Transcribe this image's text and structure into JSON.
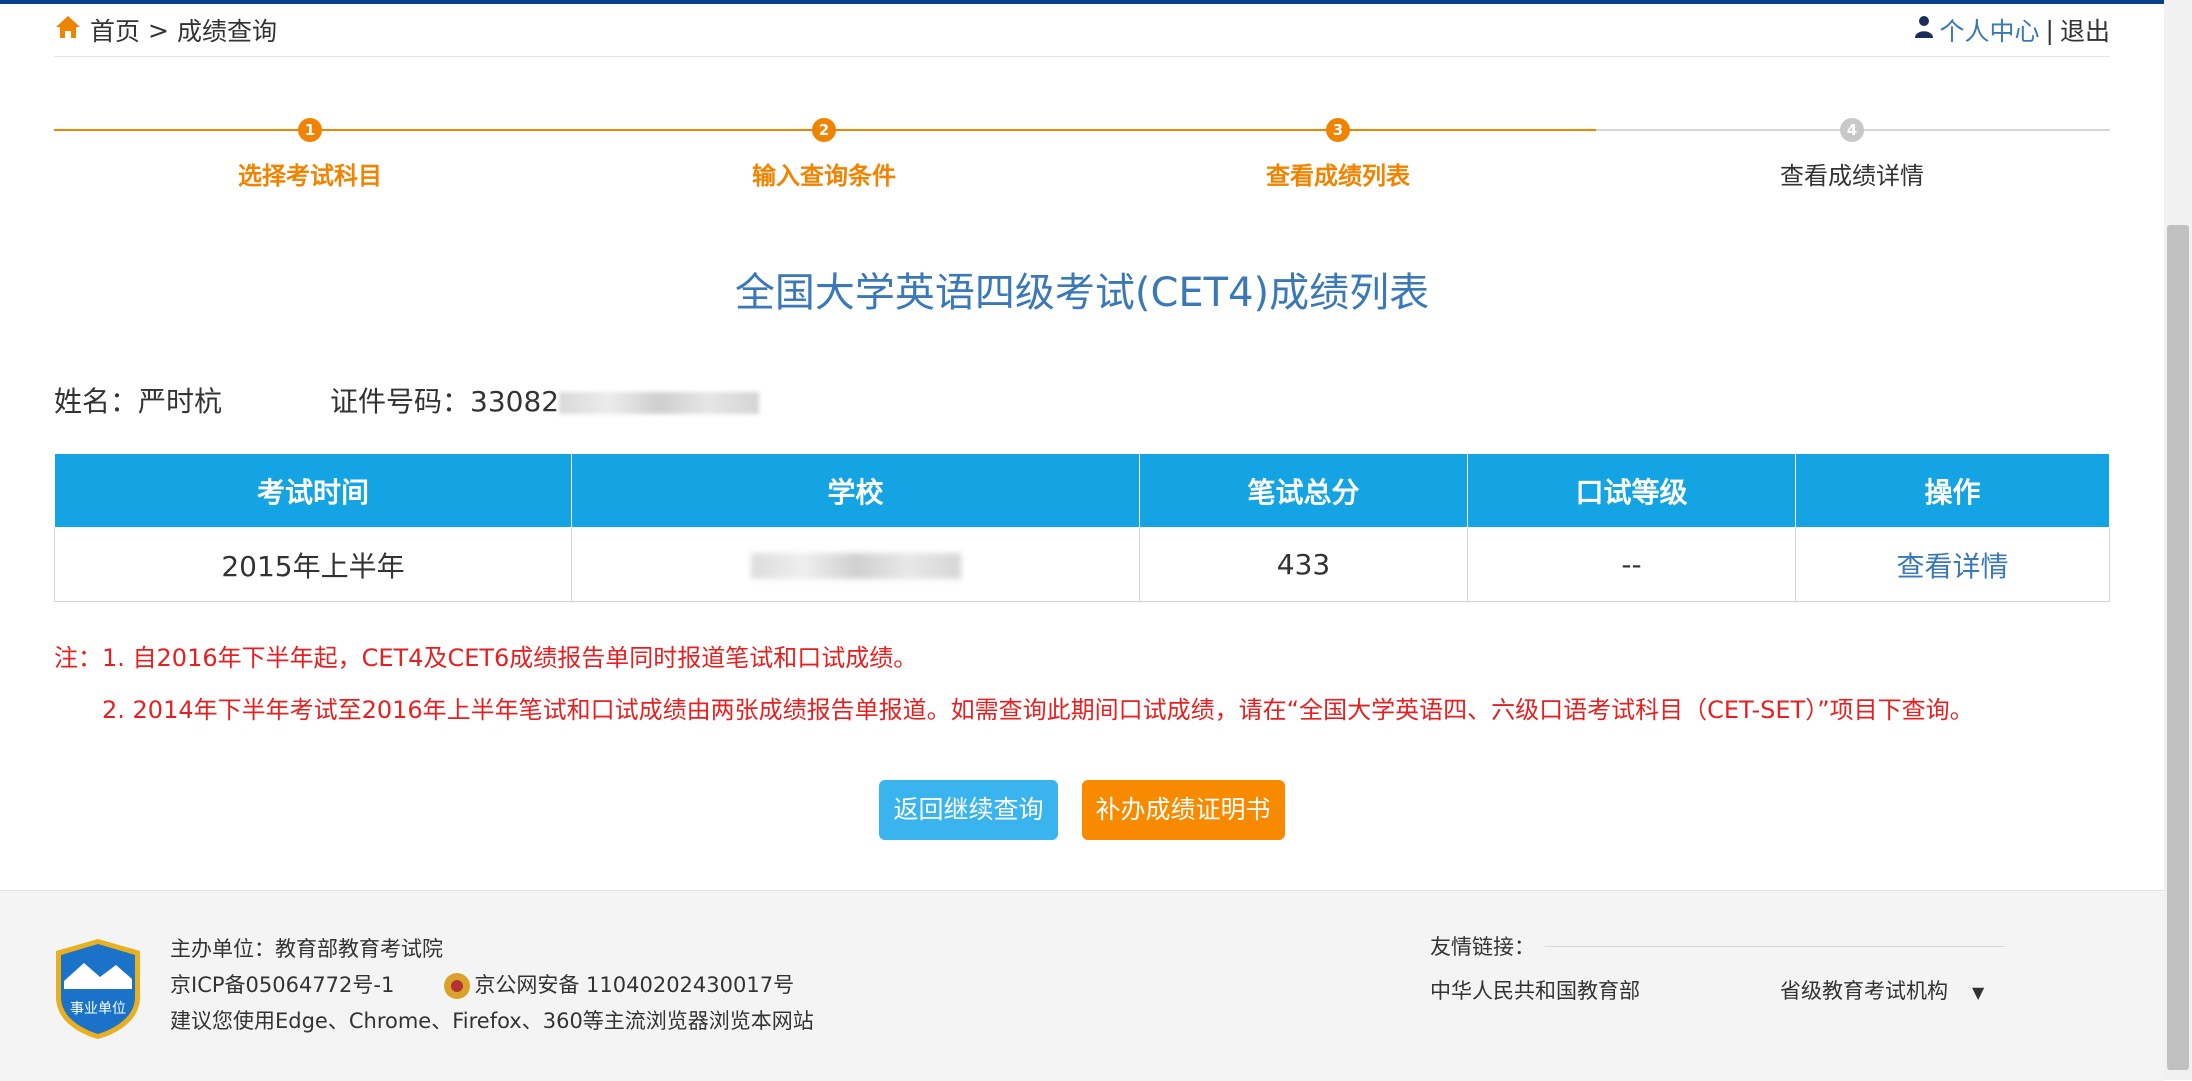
{
  "colors": {
    "top_bar": "#0b3f8a",
    "accent_orange": "#f08300",
    "table_header": "#14a4e4",
    "link_blue": "#3a78b8",
    "note_red": "#e62020",
    "btn_blue": "#3ab4ef",
    "btn_orange": "#f88a00",
    "step_gray": "#c8c8c8"
  },
  "breadcrumb": {
    "home_icon": "home-icon",
    "home": "首页",
    "separator": ">",
    "current": "成绩查询"
  },
  "user": {
    "icon": "user-icon",
    "center": "个人中心",
    "separator": "|",
    "logout": "退出"
  },
  "steps": [
    {
      "num": "1",
      "label": "选择考试科目",
      "done": true
    },
    {
      "num": "2",
      "label": "输入查询条件",
      "done": true
    },
    {
      "num": "3",
      "label": "查看成绩列表",
      "done": true
    },
    {
      "num": "4",
      "label": "查看成绩详情",
      "done": false
    }
  ],
  "page_title": "全国大学英语四级考试(CET4)成绩列表",
  "candidate": {
    "name_label": "姓名：",
    "name": "严时杭",
    "id_label": "证件号码：",
    "id_prefix": "33082"
  },
  "table": {
    "headers": [
      "考试时间",
      "学校",
      "笔试总分",
      "口试等级",
      "操作"
    ],
    "rows": [
      {
        "time": "2015年上半年",
        "score": "433",
        "oral": "--",
        "action": "查看详情"
      }
    ]
  },
  "notes": {
    "n1": "注：1. 自2016年下半年起，CET4及CET6成绩报告单同时报道笔试和口试成绩。",
    "n2": "2. 2014年下半年考试至2016年上半年笔试和口试成绩由两张成绩报告单报道。如需查询此期间口试成绩，请在“全国大学英语四、六级口语考试科目（CET-SET）”项目下查询。"
  },
  "buttons": {
    "back": "返回继续查询",
    "certificate": "补办成绩证明书"
  },
  "footer": {
    "badge_text": "事业单位",
    "organizer": "主办单位：教育部教育考试院",
    "icp": "京ICP备05064772号-1",
    "police": "京公网安备 11040202430017号",
    "browser_tip": "建议您使用Edge、Chrome、Firefox、360等主流浏览器浏览本网站",
    "links_label": "友情链接：",
    "link1": "中华人民共和国教育部",
    "link2": "省级教育考试机构",
    "dropdown_icon": "triangle-down-icon"
  }
}
